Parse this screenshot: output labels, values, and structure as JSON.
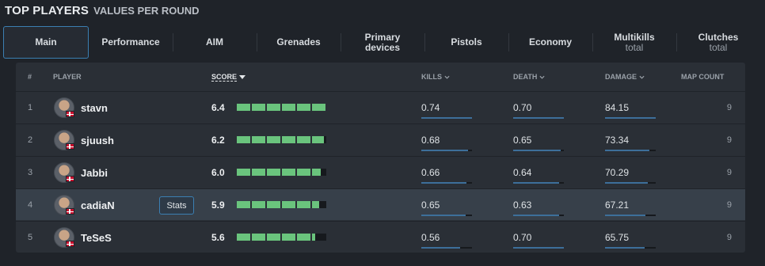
{
  "header": {
    "title": "TOP PLAYERS",
    "subtitle": "VALUES PER ROUND"
  },
  "tabs": [
    {
      "label": "Main",
      "sub": "",
      "active": true
    },
    {
      "label": "Performance",
      "sub": ""
    },
    {
      "label": "AIM",
      "sub": ""
    },
    {
      "label": "Grenades",
      "sub": ""
    },
    {
      "label": "Primary",
      "sub": "devices"
    },
    {
      "label": "Pistols",
      "sub": ""
    },
    {
      "label": "Economy",
      "sub": ""
    },
    {
      "label": "Multikills",
      "sub": "total"
    },
    {
      "label": "Clutches",
      "sub": "total"
    }
  ],
  "columns": {
    "rank": "#",
    "player": "PLAYER",
    "score": "SCORE",
    "kills": "KILLS",
    "death": "DEATH",
    "damage": "DAMAGE",
    "map_count": "MAP COUNT"
  },
  "stats_button": "Stats",
  "colors": {
    "accent": "#3b7fb2",
    "score_bar": "#6ac47d",
    "stat_bar": "#3d6f9a"
  },
  "rows": [
    {
      "rank": "1",
      "name": "stavn",
      "score": "6.4",
      "score_fill": 1.0,
      "kills": "0.74",
      "kills_fill": 1.0,
      "death": "0.70",
      "death_fill": 1.0,
      "damage": "84.15",
      "damage_fill": 1.0,
      "maps": "9"
    },
    {
      "rank": "2",
      "name": "sjuush",
      "score": "6.2",
      "score_fill": 0.97,
      "kills": "0.68",
      "kills_fill": 0.92,
      "death": "0.65",
      "death_fill": 0.93,
      "damage": "73.34",
      "damage_fill": 0.87,
      "maps": "9"
    },
    {
      "rank": "3",
      "name": "Jabbi",
      "score": "6.0",
      "score_fill": 0.94,
      "kills": "0.66",
      "kills_fill": 0.89,
      "death": "0.64",
      "death_fill": 0.91,
      "damage": "70.29",
      "damage_fill": 0.84,
      "maps": "9"
    },
    {
      "rank": "4",
      "name": "cadiaN",
      "score": "5.9",
      "score_fill": 0.92,
      "kills": "0.65",
      "kills_fill": 0.88,
      "death": "0.63",
      "death_fill": 0.9,
      "damage": "67.21",
      "damage_fill": 0.8,
      "maps": "9",
      "hovered": true
    },
    {
      "rank": "5",
      "name": "TeSeS",
      "score": "5.6",
      "score_fill": 0.88,
      "kills": "0.56",
      "kills_fill": 0.76,
      "death": "0.70",
      "death_fill": 1.0,
      "damage": "65.75",
      "damage_fill": 0.78,
      "maps": "9"
    }
  ]
}
